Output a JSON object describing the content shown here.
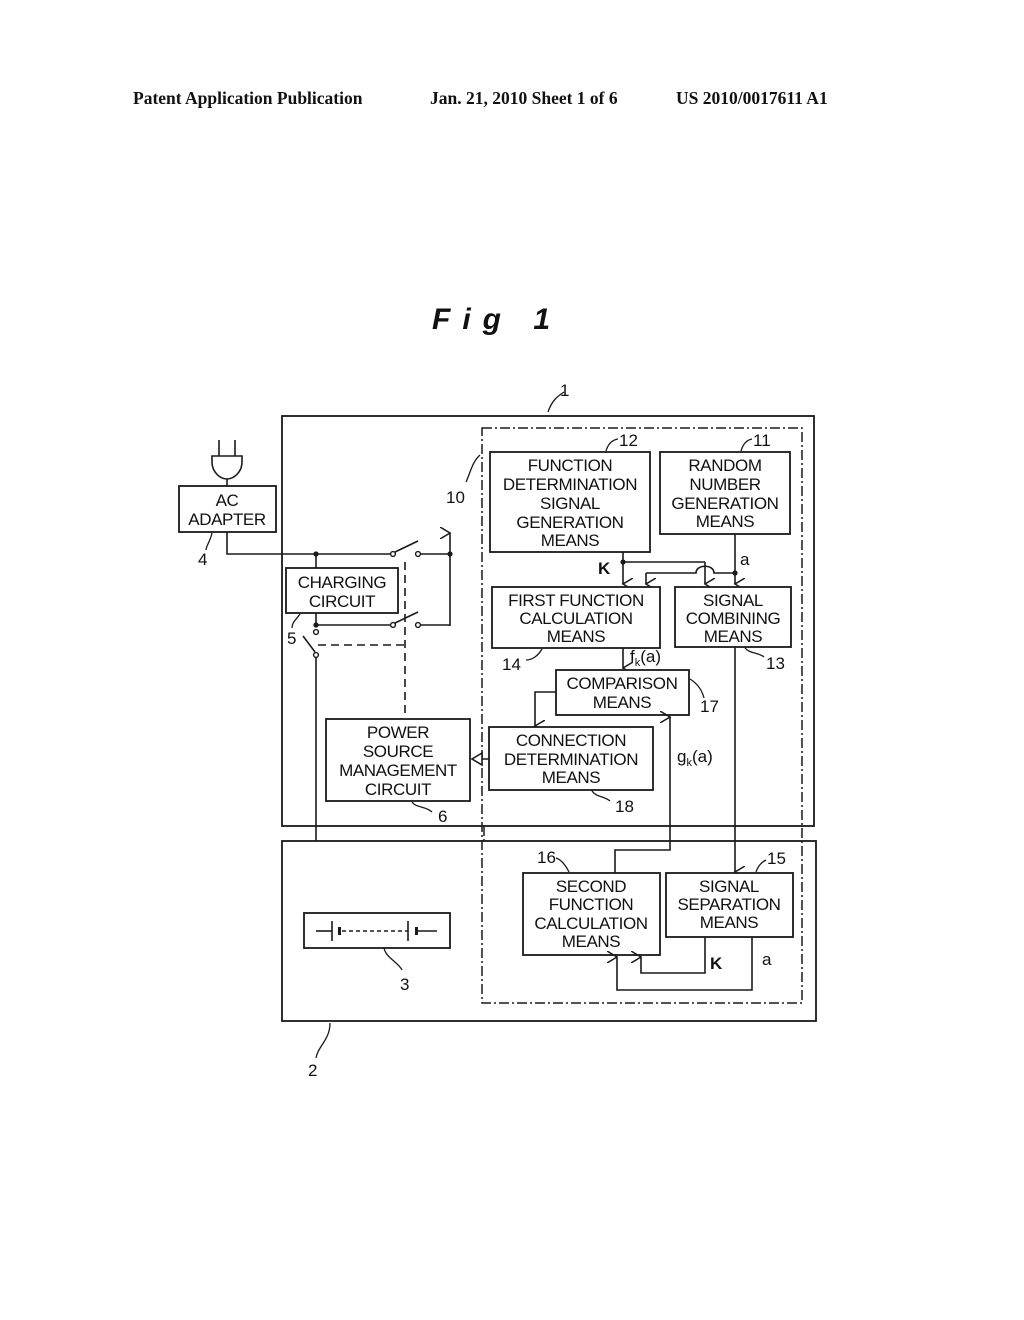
{
  "header": {
    "publication_type": "Patent Application Publication",
    "date_sheet": "Jan. 21, 2010  Sheet 1 of 6",
    "patent_number": "US 2010/0017611 A1"
  },
  "figure": {
    "title": "Fig 1",
    "reference_numerals": {
      "device": "1",
      "battery_pack": "2",
      "battery": "3",
      "ac_adapter": "4",
      "charging_circuit": "5",
      "power_source_management": "6",
      "authentication_unit": "10",
      "random_number_generation": "11",
      "function_determination_signal_generation": "12",
      "signal_combining": "13",
      "first_function_calculation": "14",
      "signal_separation": "15",
      "second_function_calculation": "16",
      "comparison": "17",
      "connection_determination": "18"
    },
    "blocks": {
      "ac_adapter": [
        "AC",
        "ADAPTER"
      ],
      "charging_circuit": [
        "CHARGING",
        "CIRCUIT"
      ],
      "power_source_management": [
        "POWER",
        "SOURCE",
        "MANAGEMENT",
        "CIRCUIT"
      ],
      "function_determination": [
        "FUNCTION",
        "DETERMINATION",
        "SIGNAL",
        "GENERATION",
        "MEANS"
      ],
      "random_number": [
        "RANDOM",
        "NUMBER",
        "GENERATION",
        "MEANS"
      ],
      "first_function": [
        "FIRST FUNCTION",
        "CALCULATION",
        "MEANS"
      ],
      "signal_combining": [
        "SIGNAL",
        "COMBINING",
        "MEANS"
      ],
      "comparison": [
        "COMPARISON",
        "MEANS"
      ],
      "connection_determination": [
        "CONNECTION",
        "DETERMINATION",
        "MEANS"
      ],
      "second_function": [
        "SECOND",
        "FUNCTION",
        "CALCULATION",
        "MEANS"
      ],
      "signal_separation": [
        "SIGNAL",
        "SEPARATION",
        "MEANS"
      ]
    },
    "signals": {
      "k_top": "K",
      "a_top": "a",
      "fk_base": "f",
      "fk_sub": "k",
      "fk_arg": "(a)",
      "gk_base": "g",
      "gk_sub": "k",
      "gk_arg": "(a)",
      "k_bottom": "K",
      "a_bottom": "a"
    }
  }
}
